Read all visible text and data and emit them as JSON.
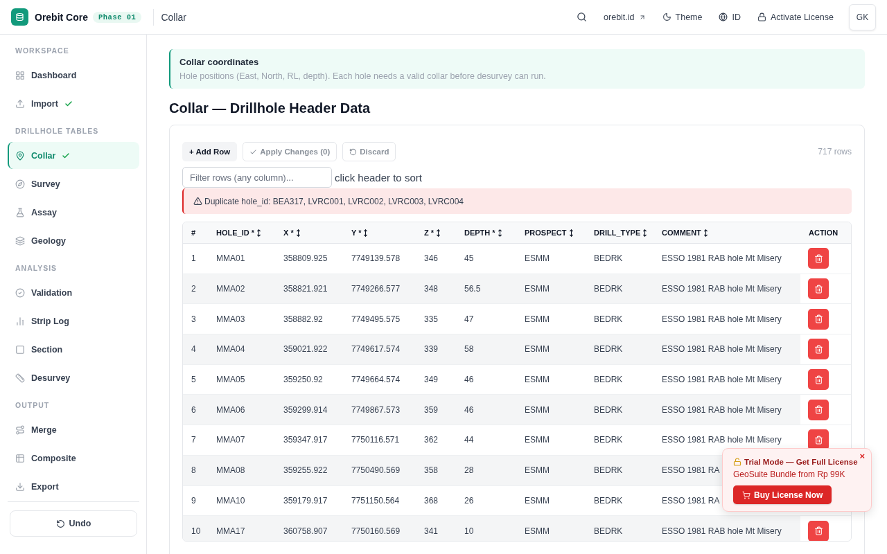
{
  "top_bar": {
    "app_name": "Orebit Core",
    "badge": "Phase 01",
    "breadcrumb": "Collar",
    "actions": [
      {
        "kind": "external",
        "label": "orebit.id"
      },
      {
        "kind": "theme",
        "label": "Theme"
      },
      {
        "kind": "language",
        "label": "ID"
      },
      {
        "kind": "license",
        "label": "Activate License"
      }
    ],
    "avatar": "GK"
  },
  "sidebar": {
    "sections": [
      {
        "title": "WORKSPACE",
        "items": [
          {
            "label": "Dashboard",
            "selected": false,
            "completed": false
          },
          {
            "label": "Import",
            "selected": false,
            "completed": true
          }
        ]
      },
      {
        "title": "DRILLHOLE TABLES",
        "items": [
          {
            "label": "Collar",
            "selected": true,
            "completed": true
          },
          {
            "label": "Survey",
            "selected": false,
            "completed": false
          },
          {
            "label": "Assay",
            "selected": false,
            "completed": false
          },
          {
            "label": "Geology",
            "selected": false,
            "completed": false
          }
        ]
      },
      {
        "title": "ANALYSIS",
        "items": [
          {
            "label": "Validation",
            "selected": false,
            "completed": false
          },
          {
            "label": "Strip Log",
            "selected": false,
            "completed": false
          },
          {
            "label": "Section",
            "selected": false,
            "completed": false
          },
          {
            "label": "Desurvey",
            "selected": false,
            "completed": false
          }
        ]
      },
      {
        "title": "OUTPUT",
        "items": [
          {
            "label": "Merge",
            "selected": false,
            "completed": false
          },
          {
            "label": "Composite",
            "selected": false,
            "completed": false
          },
          {
            "label": "Export",
            "selected": false,
            "completed": false
          }
        ]
      }
    ],
    "undo_button": "Undo"
  },
  "info_banner": {
    "title": "Collar coordinates",
    "text": "Hole positions (East, North, RL, depth). Each hole needs a valid collar before desurvey can run."
  },
  "page_title": "Collar — Drillhole Header Data",
  "toolbar": {
    "buttons": [
      {
        "kind": "add",
        "label": "+ Add Row",
        "disabled": false
      },
      {
        "kind": "apply",
        "label": "Apply Changes (0)",
        "disabled": true
      },
      {
        "kind": "discard",
        "label": "Discard",
        "disabled": true
      }
    ],
    "row_count": "717 rows"
  },
  "filter": {
    "placeholder": "Filter rows (any column)...",
    "hint": "click header to sort"
  },
  "alert": {
    "text": "Duplicate hole_id: BEA317, LVRC001, LVRC002, LVRC003, LVRC004"
  },
  "table": {
    "columns": [
      {
        "label": "#",
        "sortable": false
      },
      {
        "label": "HOLE_ID *",
        "sortable": true
      },
      {
        "label": "X *",
        "sortable": true
      },
      {
        "label": "Y *",
        "sortable": true
      },
      {
        "label": "Z *",
        "sortable": true
      },
      {
        "label": "DEPTH *",
        "sortable": true
      },
      {
        "label": "PROSPECT",
        "sortable": true
      },
      {
        "label": "DRILL_TYPE",
        "sortable": true
      },
      {
        "label": "COMMENT",
        "sortable": true
      },
      {
        "label": "ACTION",
        "sortable": false
      }
    ],
    "rows": [
      {
        "cells": [
          "1",
          "MMA01",
          "358809.925",
          "7749139.578",
          "346",
          "45",
          "ESMM",
          "BEDRK",
          "ESSO 1981 RAB hole Mt Misery"
        ]
      },
      {
        "cells": [
          "2",
          "MMA02",
          "358821.921",
          "7749266.577",
          "348",
          "56.5",
          "ESMM",
          "BEDRK",
          "ESSO 1981 RAB hole Mt Misery"
        ]
      },
      {
        "cells": [
          "3",
          "MMA03",
          "358882.92",
          "7749495.575",
          "335",
          "47",
          "ESMM",
          "BEDRK",
          "ESSO 1981 RAB hole Mt Misery"
        ]
      },
      {
        "cells": [
          "4",
          "MMA04",
          "359021.922",
          "7749617.574",
          "339",
          "58",
          "ESMM",
          "BEDRK",
          "ESSO 1981 RAB hole Mt Misery"
        ]
      },
      {
        "cells": [
          "5",
          "MMA05",
          "359250.92",
          "7749664.574",
          "349",
          "46",
          "ESMM",
          "BEDRK",
          "ESSO 1981 RAB hole Mt Misery"
        ]
      },
      {
        "cells": [
          "6",
          "MMA06",
          "359299.914",
          "7749867.573",
          "359",
          "46",
          "ESMM",
          "BEDRK",
          "ESSO 1981 RAB hole Mt Misery"
        ]
      },
      {
        "cells": [
          "7",
          "MMA07",
          "359347.917",
          "7750116.571",
          "362",
          "44",
          "ESMM",
          "BEDRK",
          "ESSO 1981 RAB hole Mt Misery"
        ]
      },
      {
        "cells": [
          "8",
          "MMA08",
          "359255.922",
          "7750490.569",
          "358",
          "28",
          "ESMM",
          "BEDRK",
          "ESSO 1981 RA"
        ]
      },
      {
        "cells": [
          "9",
          "MMA10",
          "359179.917",
          "7751150.564",
          "368",
          "26",
          "ESMM",
          "BEDRK",
          "ESSO 1981 RA"
        ]
      },
      {
        "cells": [
          "10",
          "MMA17",
          "360758.907",
          "7750160.569",
          "341",
          "10",
          "ESMM",
          "BEDRK",
          "ESSO 1981 RAB hole Mt Misery"
        ]
      }
    ]
  },
  "trial_popup": {
    "title": "Trial Mode — Get Full License",
    "text": "GeoSuite Bundle from Rp 99K",
    "button": "Buy License Now",
    "close": "×"
  }
}
